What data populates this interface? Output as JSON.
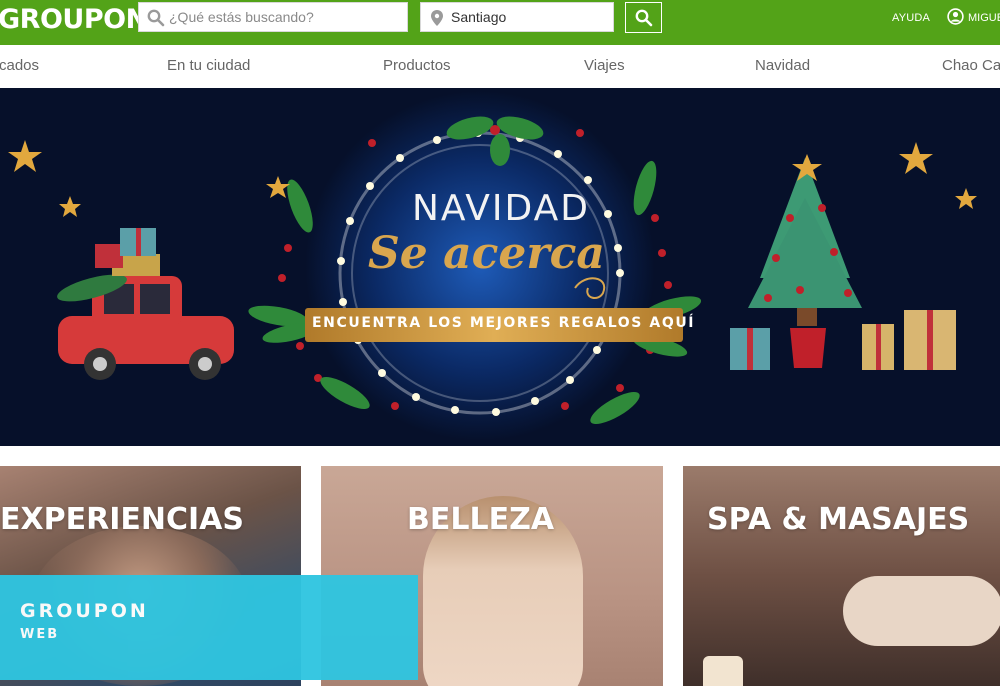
{
  "header": {
    "logo": "GROUPON",
    "search_placeholder": "¿Qué estás buscando?",
    "location_value": "Santiago",
    "help_label": "AYUDA",
    "user_label": "MIGUE"
  },
  "nav": {
    "items": [
      "cados",
      "En tu ciudad",
      "Productos",
      "Viajes",
      "Navidad",
      "Chao Cal"
    ]
  },
  "banner": {
    "title": "NAVIDAD",
    "subtitle": "Se acerca",
    "ribbon": "ENCUENTRA LOS MEJORES REGALOS AQUÍ"
  },
  "tiles": [
    {
      "title": "EXPERIENCIAS"
    },
    {
      "title": "BELLEZA"
    },
    {
      "title": "SPA & MASAJES"
    }
  ],
  "promo": {
    "title": "GROUPON",
    "subtitle": "WEB"
  },
  "colors": {
    "brand_green": "#53a318",
    "banner_navy": "#06102a",
    "ribbon_gold": "#c8933a",
    "promo_cyan": "#2fc5e0"
  }
}
